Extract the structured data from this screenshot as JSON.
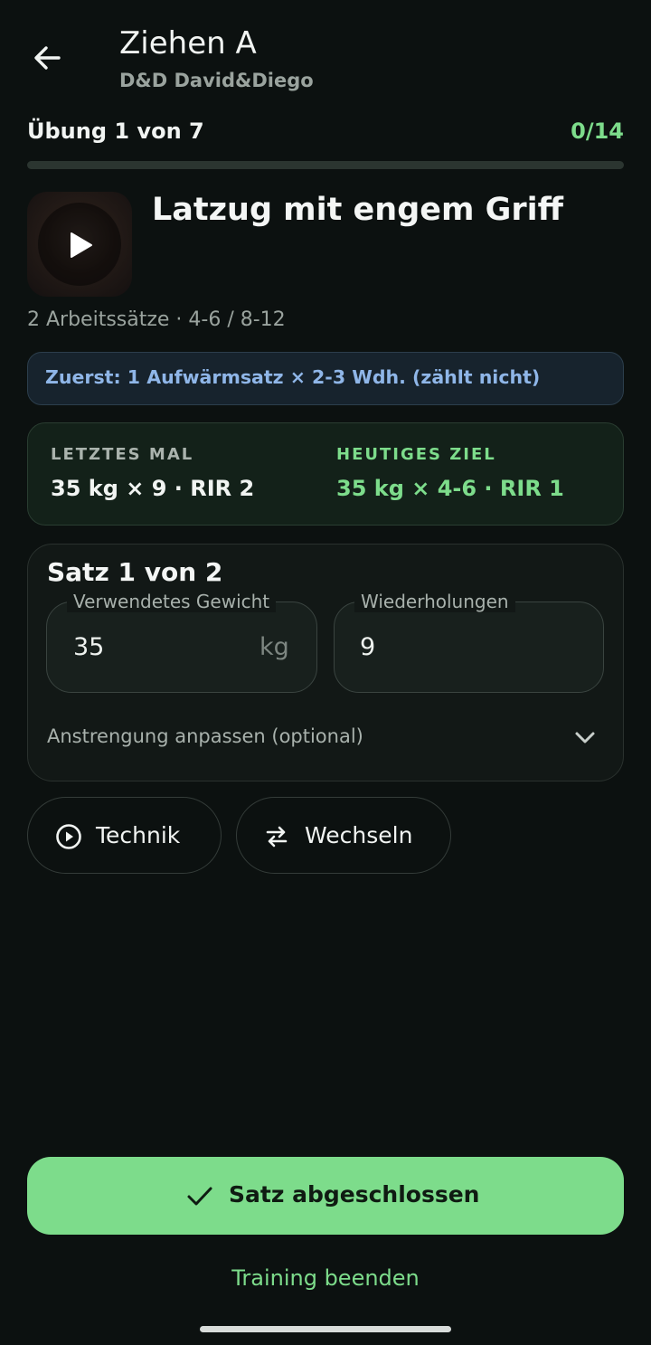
{
  "header": {
    "title": "Ziehen A",
    "subtitle": "D&D David&Diego",
    "back_icon": "arrow-left-icon"
  },
  "progress": {
    "exercise_label": "Übung 1 von 7",
    "sets_done_label": "0/14",
    "sets_done_fraction": 0
  },
  "exercise": {
    "name": "Latzug mit engem Griff",
    "meta": "2 Arbeitssätze · 4-6 / 8-12",
    "video_icon": "play-icon",
    "warmup_note": "Zuerst: 1 Aufwärmsatz × 2-3 Wdh. (zählt nicht)"
  },
  "comparison": {
    "last_label": "LETZTES MAL",
    "last_value": "35 kg × 9 · RIR 2",
    "goal_label": "HEUTIGES ZIEL",
    "goal_value": "35 kg × 4-6 · RIR 1"
  },
  "set": {
    "title": "Satz 1 von 2",
    "weight": {
      "label": "Verwendetes Gewicht",
      "value": "35",
      "unit": "kg"
    },
    "reps": {
      "label": "Wiederholungen",
      "value": "9"
    },
    "effort_toggle": "Anstrengung anpassen (optional)"
  },
  "actions": {
    "technique": "Technik",
    "swap": "Wechseln",
    "complete": "Satz abgeschlossen",
    "end_training": "Training beenden"
  },
  "colors": {
    "background": "#0c1110",
    "accent": "#7ddc8b",
    "info": "#8fb6e8"
  }
}
